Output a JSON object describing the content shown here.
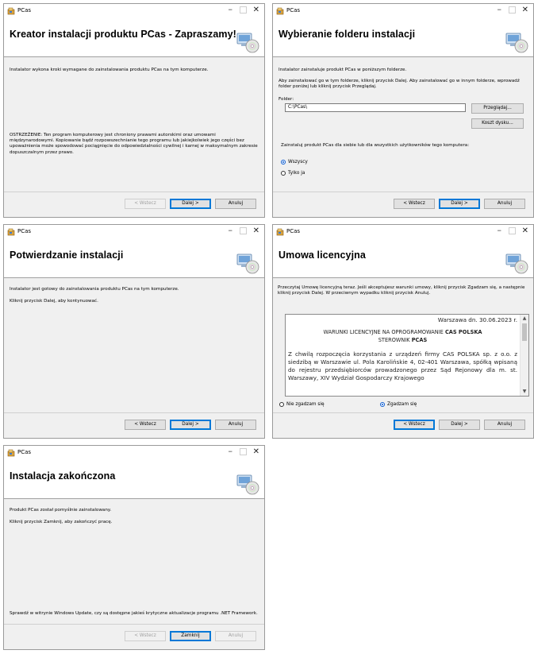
{
  "app_title": "PCas",
  "icons": {
    "app": "pcas-setup-icon",
    "header": "cd-install-icon"
  },
  "buttons": {
    "back": "< Wstecz",
    "next": "Dalej >",
    "cancel": "Anuluj",
    "close": "Zamknij"
  },
  "welcome": {
    "title": "Kreator instalacji produktu PCas - Zapraszamy!",
    "intro": "Instalator wykona kroki wymagane do zainstalowania produktu PCas na tym komputerze.",
    "warning": "OSTRZEŻENIE: Ten program komputerowy jest chroniony prawami autorskimi oraz umowami międzynarodowymi. Kopiowanie bądź rozpowszechnianie tego programu lub jakiejkolwiek jego części bez upoważnienia może spowodować pociągnięcie do odpowiedzialności cywilnej i karnej w maksymalnym zakresie dopuszczalnym przez prawo."
  },
  "folder": {
    "title": "Wybieranie folderu instalacji",
    "line1": "Instalator zainstaluje produkt PCas w poniższym folderze.",
    "line2": "Aby zainstalować go w tym folderze, kliknij przycisk Dalej. Aby zainstalować go w innym folderze, wprowadź folder poniżej lub kliknij przycisk Przeglądaj.",
    "folder_label": "Folder:",
    "folder_value": "C:\\PCas\\",
    "browse": "Przeglądaj...",
    "disk_cost": "Koszt dysku...",
    "users_prompt": "Zainstaluj produkt PCas dla siebie lub dla wszystkich użytkowników tego komputera:",
    "opt_all": "Wszyscy",
    "opt_me": "Tylko ja"
  },
  "confirm": {
    "title": "Potwierdzanie instalacji",
    "line1": "Instalator jest gotowy do zainstalowania produktu PCas na tym komputerze.",
    "line2": "Kliknij przycisk Dalej, aby kontynuować."
  },
  "license": {
    "title": "Umowa licencyjna",
    "intro": "Przeczytaj Umowę licencyjną teraz. Jeśli akceptujesz warunki umowy, kliknij przycisk Zgadzam się, a następnie kliknij przycisk Dalej. W przeciwnym wypadku kliknij przycisk Anuluj.",
    "date": "Warszawa dn. 30.06.2023 r.",
    "heading_a": "WARUNKI LICENCYJNE NA OPROGRAMOWANIE",
    "heading_b": "CAS POLSKA",
    "heading_c": "STEROWNIK",
    "heading_d": "PCAS",
    "body": "Z chwilą rozpoczęcia korzystania z urządzeń firmy CAS POLSKA sp. z o.o. z siedzibą w Warszawie ul. Pola Karolińskie 4, 02-401 Warszawa, spółką wpisaną do rejestru przedsiębiorców prowadzonego przez Sąd Rejonowy dla m. st. Warszawy, XIV Wydział Gospodarczy Krajowego",
    "disagree": "Nie zgadzam się",
    "agree": "Zgadzam się"
  },
  "finish": {
    "title": "Instalacja zakończona",
    "line1": "Produkt PCas został pomyślnie zainstalowany.",
    "line2": "Kliknij przycisk Zamknij, aby zakończyć pracę.",
    "update_note": "Sprawdź w witrynie Windows Update, czy są dostępne jakieś krytyczne aktualizacje programu .NET Framework."
  }
}
